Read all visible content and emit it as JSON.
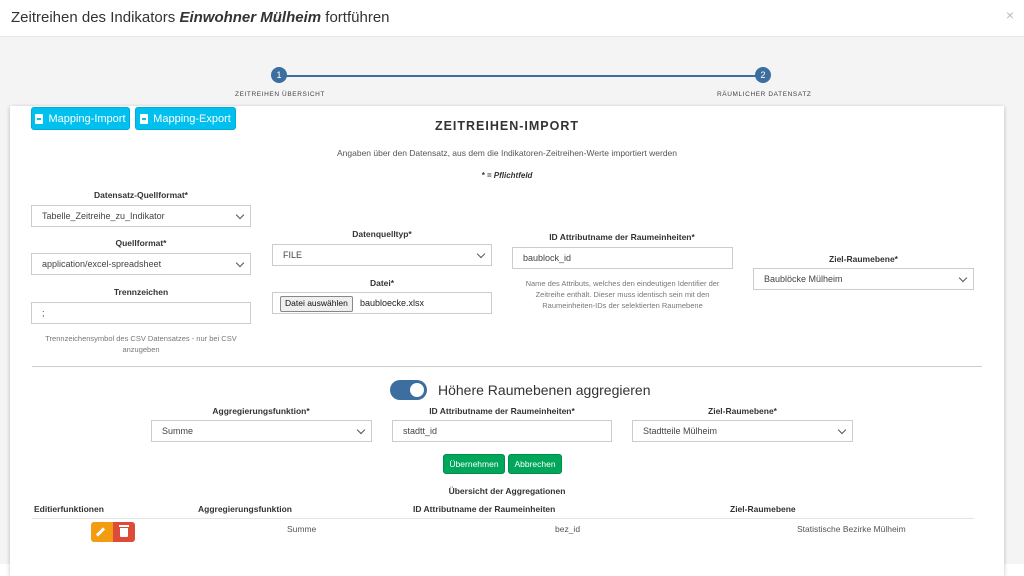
{
  "header": {
    "title_prefix": "Zeitreihen des Indikators",
    "indicator_name": "Einwohner Mülheim",
    "title_suffix": "fortführen",
    "close_symbol": "×"
  },
  "stepper": {
    "steps": [
      {
        "number": "1",
        "label": "ZEITREIHEN ÜBERSICHT"
      },
      {
        "number": "2",
        "label": "RÄUMLICHER DATENSATZ"
      }
    ],
    "color": "#3c6e9f"
  },
  "toolbar": {
    "mapping_import_label": "Mapping-Import",
    "mapping_export_label": "Mapping-Export",
    "mapping_import_icon": "file-import-icon",
    "mapping_export_icon": "file-export-icon"
  },
  "panel": {
    "title": "ZEITREIHEN-IMPORT",
    "subtitle": "Angaben über den Datensatz, aus dem die Indikatoren-Zeitreihen-Werte importiert werden",
    "required_note": "* = Pflichtfeld"
  },
  "form": {
    "datensatz_quellformat": {
      "label": "Datensatz-Quellformat*",
      "value": "Tabelle_Zeitreihe_zu_Indikator"
    },
    "quellformat": {
      "label": "Quellformat*",
      "value": "application/excel-spreadsheet"
    },
    "trennzeichen": {
      "label": "Trennzeichen",
      "value": ";",
      "help": "Trennzeichensymbol des CSV Datensatzes - nur bei CSV anzugeben"
    },
    "datenquelltyp": {
      "label": "Datenquelltyp*",
      "value": "FILE"
    },
    "datei": {
      "label": "Datei*",
      "button_label": "Datei auswählen",
      "file_name": "baubloecke.xlsx"
    },
    "id_attribut": {
      "label": "ID Attributname der Raumeinheiten*",
      "value": "baublock_id",
      "help": "Name des Attributs, welches den eindeutigen Identifier der Zeitreihe enthält. Dieser muss identisch sein mit den Raumeinheiten-IDs der selektierten Raumebene"
    },
    "ziel_raumebene": {
      "label": "Ziel-Raumebene*",
      "value": "Baublöcke Mülheim"
    }
  },
  "aggregation": {
    "toggle_label": "Höhere Raumebenen aggregieren",
    "toggle_on": true,
    "funktion": {
      "label": "Aggregierungsfunktion*",
      "value": "Summe"
    },
    "id_attribut": {
      "label": "ID Attributname der Raumeinheiten*",
      "value": "stadtt_id"
    },
    "ziel_raumebene": {
      "label": "Ziel-Raumebene*",
      "value": "Stadtteile Mülheim"
    },
    "apply_label": "Übernehmen",
    "cancel_label": "Abbrechen",
    "overview_title": "Übersicht der Aggregationen",
    "table": {
      "headers": [
        "Editierfunktionen",
        "Aggregierungsfunktion",
        "ID Attributname der Raumeinheiten",
        "Ziel-Raumebene"
      ],
      "rows": [
        {
          "funktion": "Summe",
          "id_attribut": "bez_id",
          "ziel_raumebene": "Statistische Bezirke Mülheim"
        }
      ]
    }
  },
  "colors": {
    "cyan_button": "#00c0ef",
    "green_button": "#00a65a",
    "edit_button": "#f39c12",
    "delete_button": "#dd4b39"
  }
}
